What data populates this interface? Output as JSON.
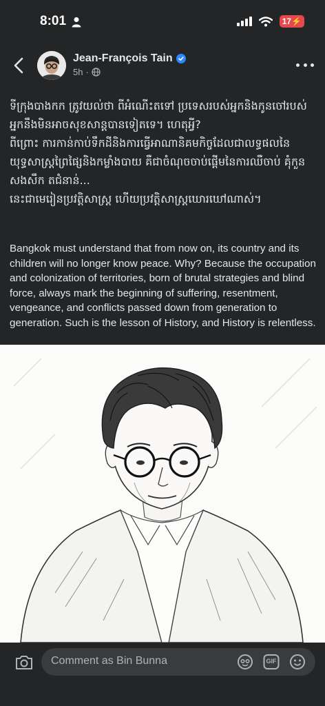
{
  "status_bar": {
    "time": "8:01",
    "battery": "17"
  },
  "post": {
    "author": "Jean-François Tain",
    "age": "5h",
    "khmer_lines": [
      "ទីក្រុងបាងកក ត្រូវយល់ថា ពីអំណើះតទៅ ប្រទេសរបស់អ្នកនិងកូនចៅរបស់",
      "អ្នកនឹងមិនអាចសុខសាន្តបានទៀតទេ។ ហេតុអ្វី?",
      "ពីព្រោះ ការកាន់កាប់ទឹកដីនិងការធ្វើអាណានិគមកិច្ចដែលជាលទ្ធផលនៃ",
      "យុទ្ធសាស្ត្រព្រៃផ្សៃនិងកម្លាំងបាយ គឺជាចំណុចចាប់ផ្តើមនៃការឈឺចាប់ គុំកួន",
      "សងសឹក តជំនាន់...",
      "នេះជាមេរៀនប្រវត្តិសាស្ត្រ ហើយប្រវត្តិសាស្ត្រឃោរឃៅណាស់។"
    ],
    "english_text": "Bangkok must understand that from now on, its country and its children will no longer know peace. Why? Because the occupation and colonization of territories, born of brutal strategies and blind force, always mark the beginning of suffering, resentment, vengeance, and conflicts passed down from generation to generation. Such is the lesson of History, and History is relentless."
  },
  "comment_bar": {
    "placeholder": "Comment as Bin Bunna",
    "gif_label": "GIF"
  },
  "icons": {
    "back": "chevron-left-icon",
    "more": "more-horizontal-icon",
    "privacy": "globe-icon",
    "verified": "verified-badge-icon",
    "camera": "camera-icon",
    "avatar_sticker": "avatar-sticker-icon",
    "gif": "gif-icon",
    "emoji": "emoji-icon"
  },
  "colors": {
    "background": "#242526",
    "accent": "#2d88ff",
    "battery": "#e5484d",
    "input": "#3a3b3c"
  }
}
